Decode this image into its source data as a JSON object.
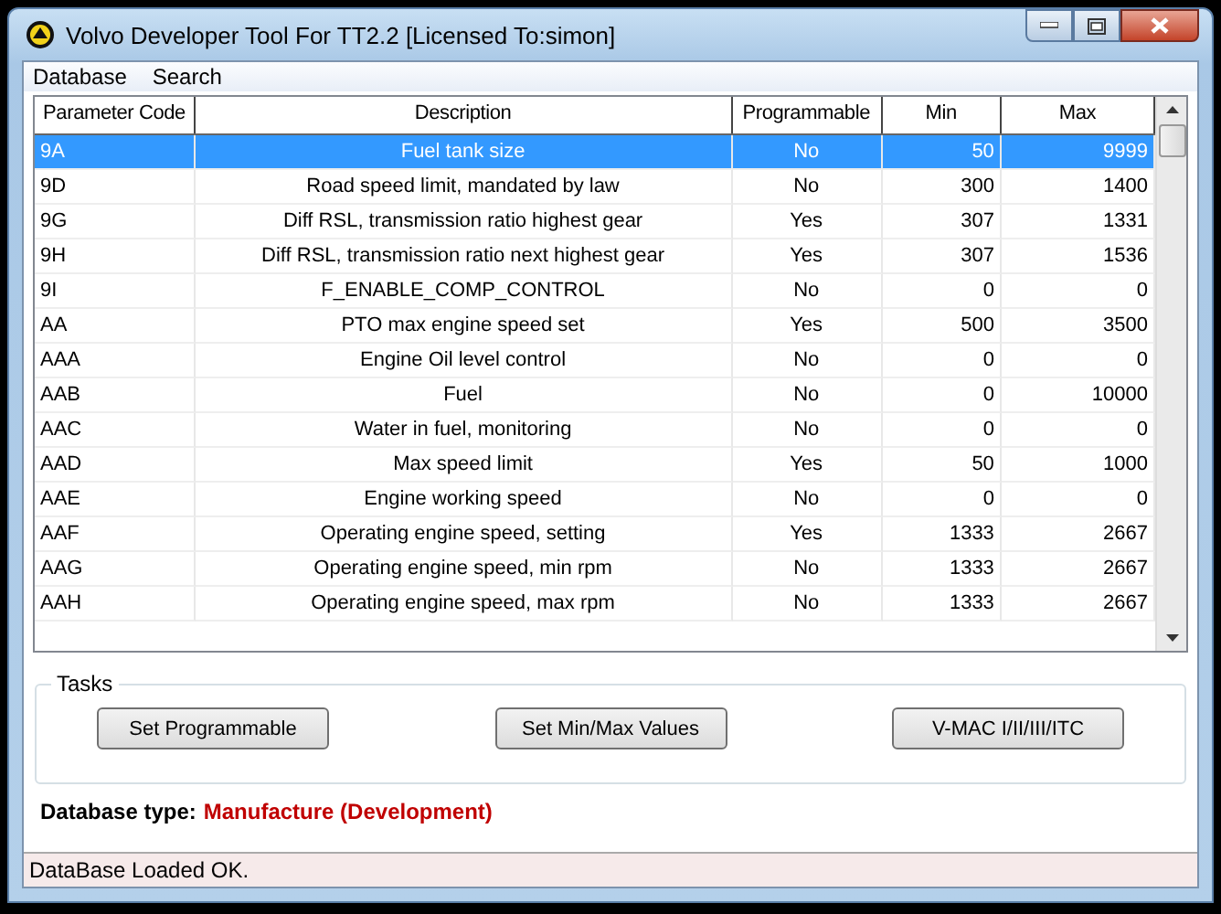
{
  "window": {
    "title": "Volvo Developer Tool For TT2.2 [Licensed To:simon]"
  },
  "menu": [
    "Database",
    "Search"
  ],
  "table": {
    "columns": [
      "Parameter Code",
      "Description",
      "Programmable",
      "Min",
      "Max"
    ],
    "rows": [
      {
        "cells": [
          "9A",
          "Fuel tank size",
          "No",
          "50",
          "9999"
        ],
        "selected": true
      },
      {
        "cells": [
          "9D",
          "Road speed limit, mandated by law",
          "No",
          "300",
          "1400"
        ],
        "selected": false
      },
      {
        "cells": [
          "9G",
          "Diff RSL, transmission ratio highest gear",
          "Yes",
          "307",
          "1331"
        ],
        "selected": false
      },
      {
        "cells": [
          "9H",
          "Diff RSL, transmission ratio next highest gear",
          "Yes",
          "307",
          "1536"
        ],
        "selected": false
      },
      {
        "cells": [
          "9I",
          "F_ENABLE_COMP_CONTROL",
          "No",
          "0",
          "0"
        ],
        "selected": false
      },
      {
        "cells": [
          "AA",
          "PTO max engine speed set",
          "Yes",
          "500",
          "3500"
        ],
        "selected": false
      },
      {
        "cells": [
          "AAA",
          "Engine Oil level control",
          "No",
          "0",
          "0"
        ],
        "selected": false
      },
      {
        "cells": [
          "AAB",
          "Fuel",
          "No",
          "0",
          "10000"
        ],
        "selected": false
      },
      {
        "cells": [
          "AAC",
          "Water in fuel, monitoring",
          "No",
          "0",
          "0"
        ],
        "selected": false
      },
      {
        "cells": [
          "AAD",
          "Max speed limit",
          "Yes",
          "50",
          "1000"
        ],
        "selected": false
      },
      {
        "cells": [
          "AAE",
          "Engine working speed",
          "No",
          "0",
          "0"
        ],
        "selected": false
      },
      {
        "cells": [
          "AAF",
          "Operating engine speed, setting",
          "Yes",
          "1333",
          "2667"
        ],
        "selected": false
      },
      {
        "cells": [
          "AAG",
          "Operating engine speed, min rpm",
          "No",
          "1333",
          "2667"
        ],
        "selected": false
      },
      {
        "cells": [
          "AAH",
          "Operating engine speed, max rpm",
          "No",
          "1333",
          "2667"
        ],
        "selected": false
      }
    ]
  },
  "tasks": {
    "title": "Tasks",
    "buttons": [
      "Set Programmable",
      "Set Min/Max Values",
      "V-MAC I/II/III/ITC"
    ]
  },
  "database_type": {
    "label": "Database type:",
    "value": "Manufacture (Development)"
  },
  "status_bar": "DataBase Loaded OK."
}
